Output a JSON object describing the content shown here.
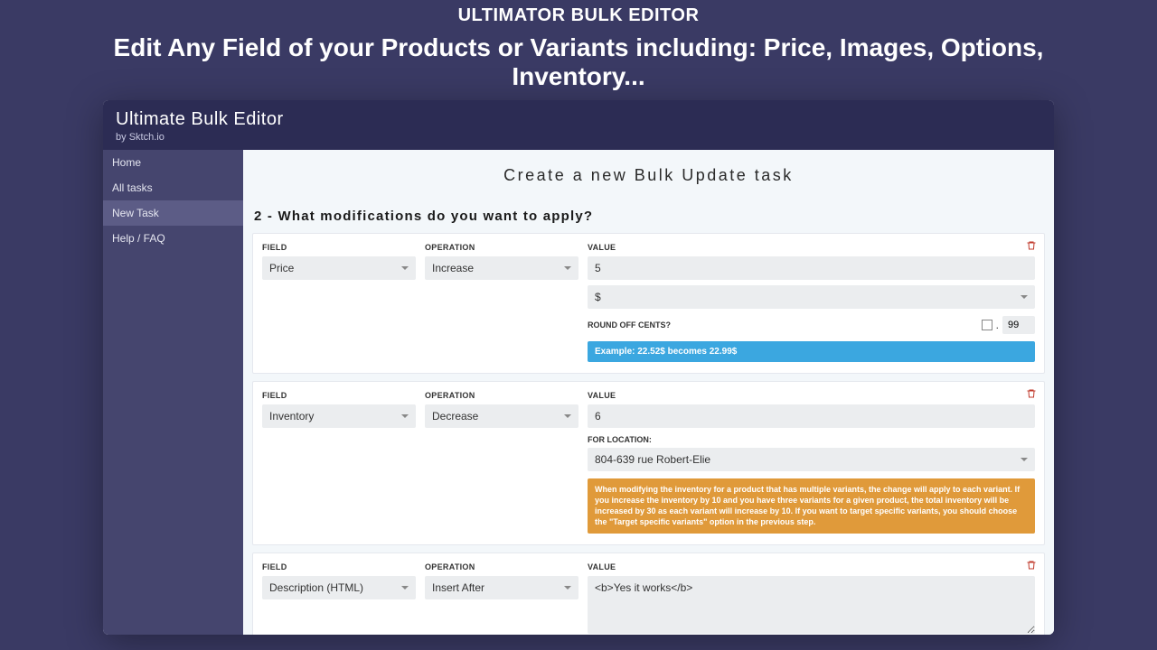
{
  "hero": {
    "title": "ULTIMATOR BULK EDITOR",
    "subtitle": "Edit Any Field of your Products or Variants including: Price, Images, Options, Inventory..."
  },
  "app": {
    "title": "Ultimate Bulk Editor",
    "byline_prefix": "by ",
    "byline_name": "Sktch.io"
  },
  "sidebar": {
    "items": [
      {
        "label": "Home",
        "active": false
      },
      {
        "label": "All tasks",
        "active": false
      },
      {
        "label": "New Task",
        "active": true
      },
      {
        "label": "Help / FAQ",
        "active": false
      }
    ]
  },
  "main": {
    "title": "Create a new Bulk Update task",
    "step_title": "2 - What modifications do you want to apply?",
    "labels": {
      "field": "FIELD",
      "operation": "OPERATION",
      "value": "VALUE",
      "roundoff": "ROUND OFF CENTS?",
      "for_location": "FOR LOCATION:"
    },
    "rules": [
      {
        "field": "Price",
        "operation": "Increase",
        "value": "5",
        "currency": "$",
        "roundoff_checked": false,
        "roundoff_cents": "99",
        "example": "Example: 22.52$ becomes 22.99$"
      },
      {
        "field": "Inventory",
        "operation": "Decrease",
        "value": "6",
        "location": "804-639 rue Robert-Elie",
        "warning": "When modifying the inventory for a product that has multiple variants, the change will apply to each variant. If you increase the inventory by 10 and you have three variants for a given product, the total inventory will be increased by 30 as each variant will increase by 10. If you want to target specific variants, you should choose the \"Target specific variants\" option in the previous step."
      },
      {
        "field": "Description (HTML)",
        "operation": "Insert After",
        "value": "<b>Yes it works</b>"
      }
    ]
  }
}
